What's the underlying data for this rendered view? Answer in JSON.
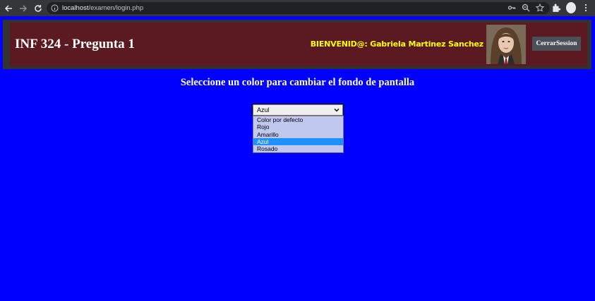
{
  "browser": {
    "url_host": "localhost",
    "url_path": "/examen/login.php"
  },
  "header": {
    "title": "INF 324 - Pregunta 1",
    "welcome_label": "BIENVENID@:",
    "user_name": "Gabriela Martinez Sanchez",
    "logout_label": "CerrarSession"
  },
  "main": {
    "heading": "Seleccione un color para cambiar el fondo de pantalla",
    "select": {
      "value": "Azul",
      "options": [
        "Color por defecto",
        "Rojo",
        "Amarillo",
        "Azul",
        "Rosado"
      ],
      "selected_index": 3
    }
  },
  "colors": {
    "page_background": "#0000ff",
    "header_background": "#5b1922",
    "welcome_text": "#ffff00",
    "option_highlight": "#1e90ff"
  }
}
